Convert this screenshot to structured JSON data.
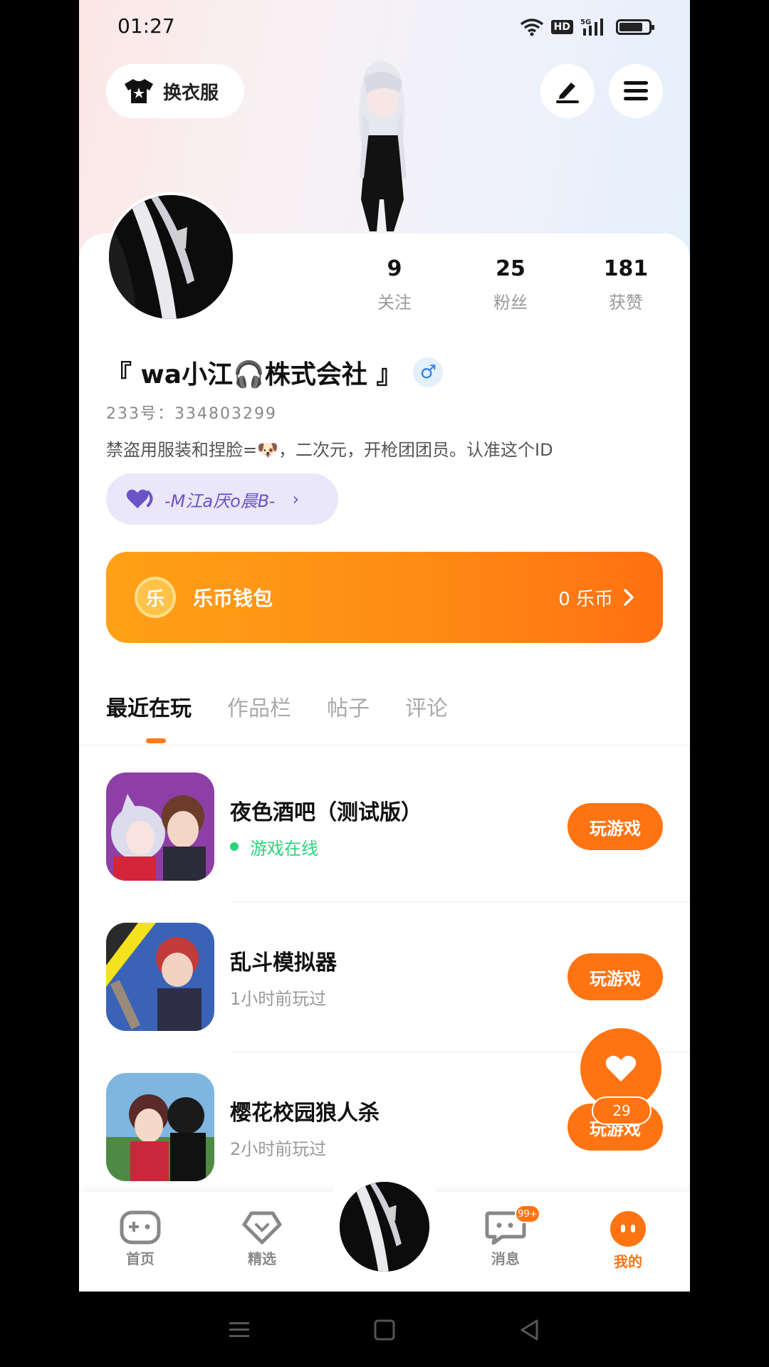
{
  "status_bar": {
    "time": "01:27",
    "hd": "HD",
    "network": "5G"
  },
  "header": {
    "dress_label": "换衣服",
    "icons": [
      "tshirt-icon",
      "edit-icon",
      "menu-icon"
    ]
  },
  "stats": [
    {
      "num": "9",
      "label": "关注"
    },
    {
      "num": "25",
      "label": "粉丝"
    },
    {
      "num": "181",
      "label": "获赞"
    }
  ],
  "profile": {
    "username": "『 wa小江🎧株式会社 』",
    "gender": "♂",
    "uid": "233号：334803299",
    "bio": "禁盗用服装和捏脸=🐶，二次元，开枪团团员。认准这个ID",
    "guild": "-M江a厌o晨B-"
  },
  "wallet": {
    "label": "乐币钱包",
    "coin_symbol": "乐",
    "balance": "0 乐币"
  },
  "tabs": [
    "最近在玩",
    "作品栏",
    "帖子",
    "评论"
  ],
  "games": [
    {
      "title": "夜色酒吧（测试版）",
      "sub": "游戏在线",
      "online": true,
      "button": "玩游戏"
    },
    {
      "title": "乱斗模拟器",
      "sub": "1小时前玩过",
      "online": false,
      "button": "玩游戏"
    },
    {
      "title": "樱花校园狼人杀",
      "sub": "2小时前玩过",
      "online": false,
      "button": "玩游戏"
    }
  ],
  "like": {
    "count": "29"
  },
  "bottom_nav": [
    {
      "label": "首页"
    },
    {
      "label": "精选"
    },
    {
      "label": "消息",
      "badge": "99+"
    },
    {
      "label": "我的"
    }
  ],
  "colors": {
    "accent": "#ff7412",
    "online": "#2bd47a",
    "guild_text": "#6a52c7"
  }
}
